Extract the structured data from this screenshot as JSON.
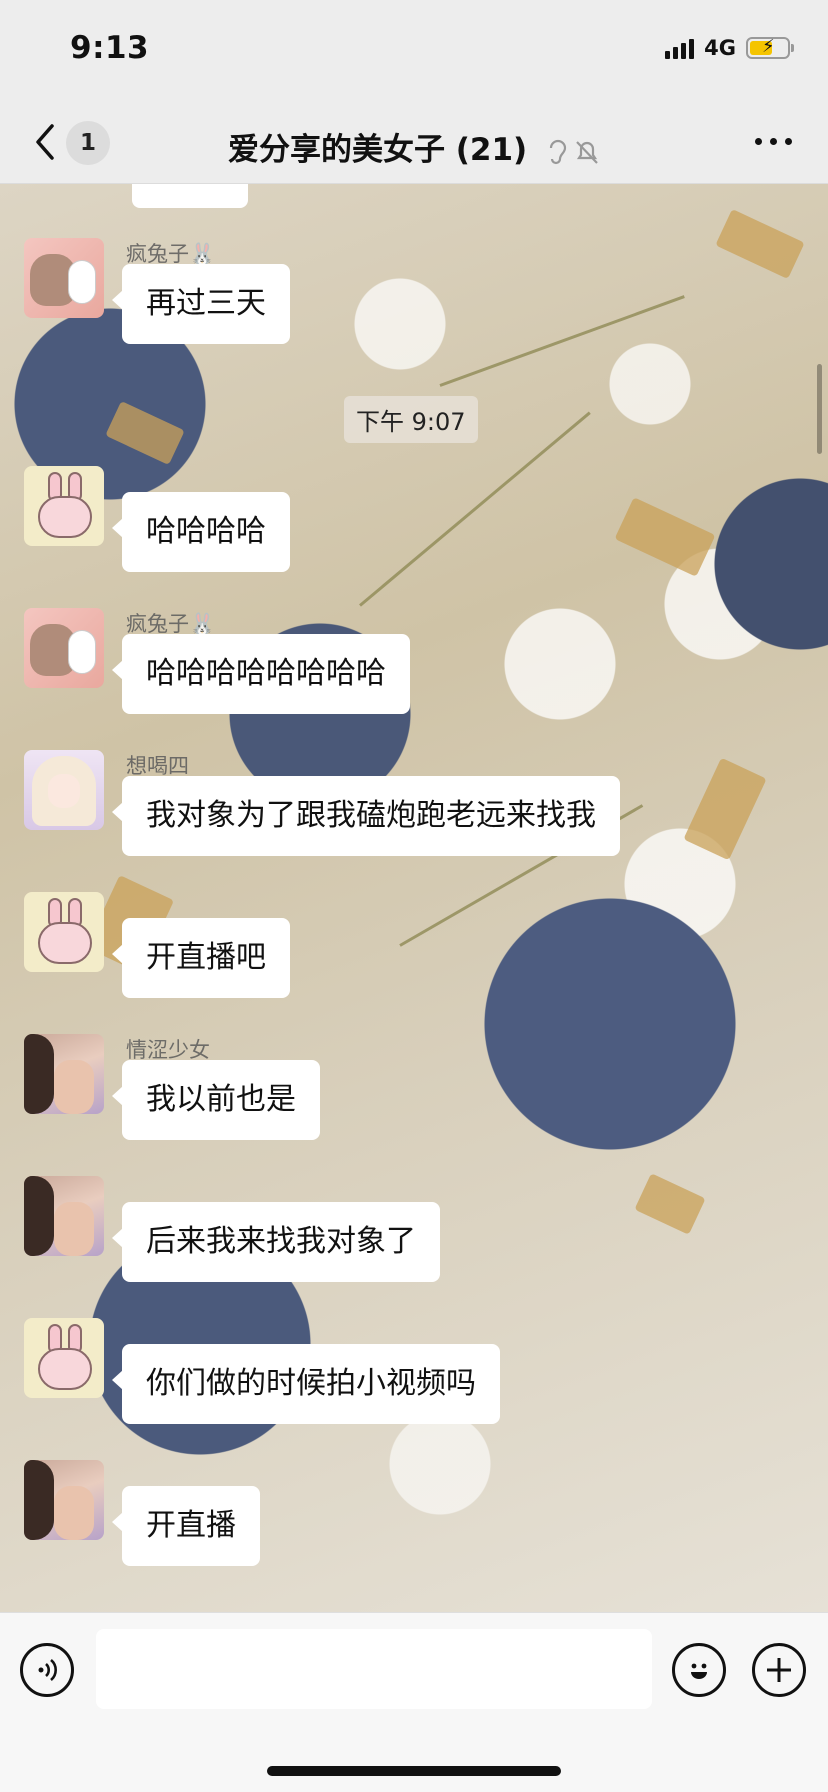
{
  "status": {
    "time": "9:13",
    "network": "4G"
  },
  "nav": {
    "unread_count": "1",
    "title": "爱分享的美女子 (21)"
  },
  "timestamp": "下午 9:07",
  "messages": [
    {
      "avatar": "fox-bunny-avatar",
      "nick": "疯兔子🐰",
      "text": "再过三天"
    },
    {
      "avatar": "pink-bunny-avatar",
      "nick": "",
      "text": "哈哈哈哈"
    },
    {
      "avatar": "fox-bunny-avatar",
      "nick": "疯兔子🐰",
      "text": "哈哈哈哈哈哈哈哈"
    },
    {
      "avatar": "anime-girl-avatar",
      "nick": "想喝四",
      "text": "我对象为了跟我磕炮跑老远来找我"
    },
    {
      "avatar": "pink-bunny-avatar",
      "nick": "",
      "text": "开直播吧"
    },
    {
      "avatar": "photo-girl-avatar",
      "nick": "情涩少女",
      "text": "我以前也是"
    },
    {
      "avatar": "photo-girl-avatar",
      "nick": "",
      "text": "后来我来找我对象了"
    },
    {
      "avatar": "pink-bunny-avatar",
      "nick": "",
      "text": "你们做的时候拍小视频吗"
    },
    {
      "avatar": "photo-girl-avatar",
      "nick": "",
      "text": "开直播"
    }
  ],
  "input": {
    "placeholder": ""
  },
  "colors": {
    "bubble": "#ffffff",
    "bar_bg": "#ededed",
    "battery": "#f5c400"
  }
}
